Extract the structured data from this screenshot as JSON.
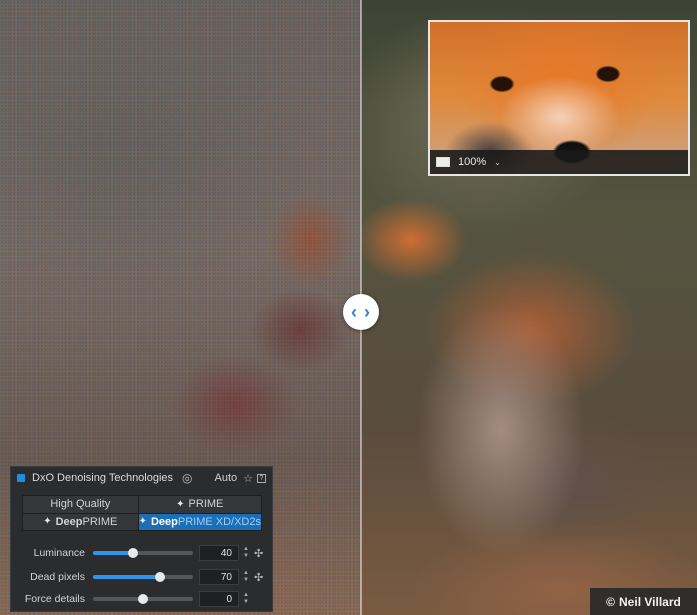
{
  "loupe": {
    "zoom": "100%",
    "zoom_caret": "⌄",
    "view_icon": "frame-icon"
  },
  "compare_handle": {
    "glyph": "‹ ›",
    "icon": "split-compare-icon"
  },
  "credit": {
    "symbol": "©",
    "text": "Neil Villard"
  },
  "panel": {
    "title": "DxO Denoising Technologies",
    "eye_icon": "hide-eye-icon",
    "eye_glyph": "◎",
    "auto_label": "Auto",
    "star_glyph": "☆",
    "help_glyph": "?",
    "modes": [
      {
        "label": "High Quality",
        "active": false
      },
      {
        "icon_glyph": "✦",
        "label": "PRIME",
        "active": false
      },
      {
        "icon_glyph": "✦",
        "label_bold": "Deep",
        "label": "PRIME",
        "active": false
      },
      {
        "icon_glyph": "✦",
        "label_bold": "Deep",
        "label": "PRIME XD/XD2s",
        "active": true
      }
    ],
    "sliders": [
      {
        "label": "Luminance",
        "value": "40",
        "fraction": 0.4,
        "wand": "✣"
      },
      {
        "label": "Dead pixels",
        "value": "70",
        "fraction": 0.67,
        "wand": "✣"
      },
      {
        "label": "Force details",
        "value": "0",
        "fraction": 0.5
      }
    ]
  },
  "colors": {
    "accent": "#1c6fb5",
    "slider_fill": "#2f95e8",
    "panel_bg": "#2b2c2e"
  }
}
